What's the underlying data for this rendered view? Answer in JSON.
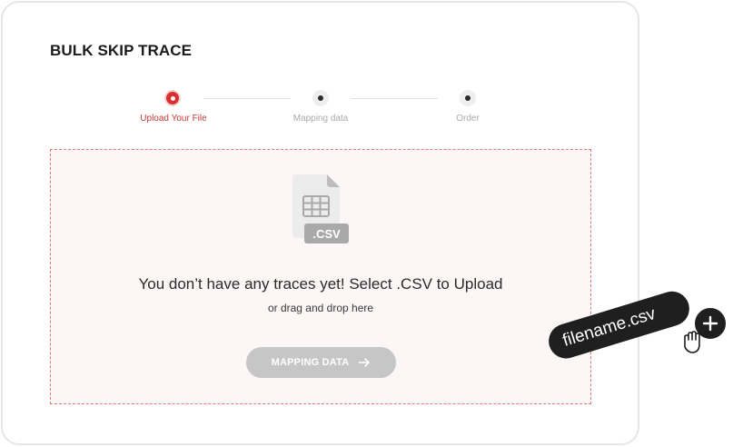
{
  "page": {
    "title": "BULK SKIP TRACE"
  },
  "stepper": {
    "steps": [
      {
        "label": "Upload Your File",
        "active": true
      },
      {
        "label": "Mapping data",
        "active": false
      },
      {
        "label": "Order",
        "active": false
      }
    ]
  },
  "dropzone": {
    "file_badge": ".CSV",
    "message": "You don’t have any traces yet! Select .CSV to Upload",
    "sub_message": "or drag and drop here",
    "button_label": "MAPPING DATA"
  },
  "drag_chip": {
    "filename": "filename.csv"
  },
  "colors": {
    "accent": "#d9302f",
    "dashed_border": "#e07a7a",
    "dropzone_bg": "#fdf6f6",
    "button_disabled": "#c6c6c6"
  }
}
